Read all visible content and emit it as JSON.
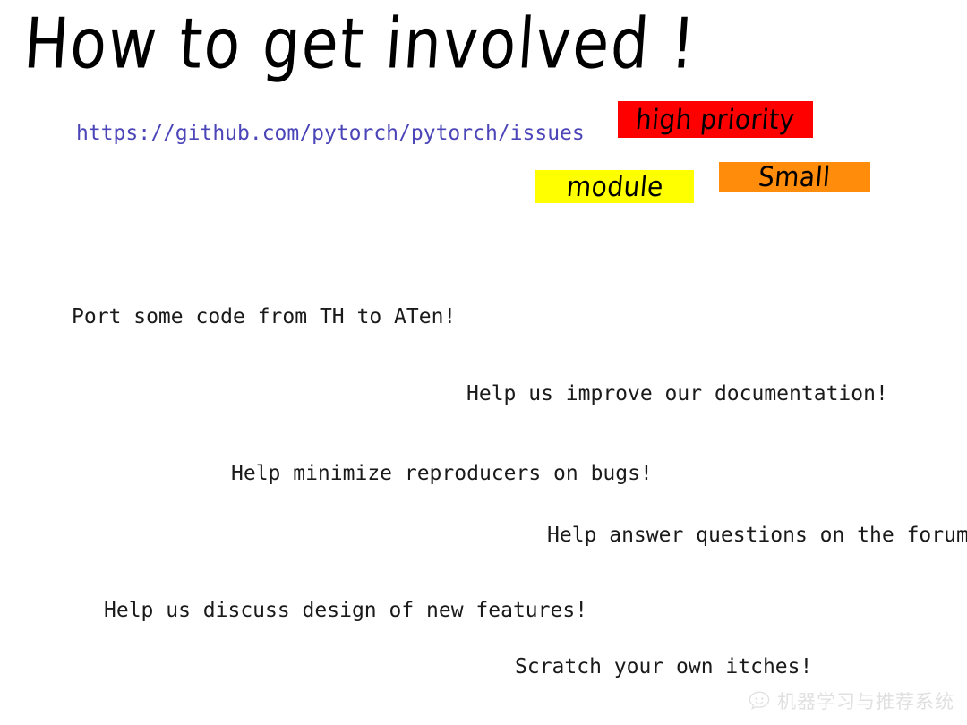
{
  "slide": {
    "title": "How to get  involved !",
    "issues_url": "https://github.com/pytorch/pytorch/issues",
    "background_color": "#ffffff"
  },
  "label_tags": [
    {
      "text": "high priority",
      "background_color": "#ff0000",
      "text_color": "#000000"
    },
    {
      "text": "module",
      "background_color": "#ffff00",
      "text_color": "#000000"
    },
    {
      "text": "Small",
      "background_color": "#ff8c0a",
      "text_color": "#000000"
    }
  ],
  "contribution_lines": [
    {
      "text": "Port some code from TH to ATen!"
    },
    {
      "text": "Help us improve our documentation!"
    },
    {
      "text": "Help minimize reproducers on bugs!"
    },
    {
      "text": "Help answer questions on the forums"
    },
    {
      "text": "Help us discuss design of new features!"
    },
    {
      "text": "Scratch your own itches!"
    }
  ],
  "watermark": {
    "icon": "speech-bubble-smiley-icon",
    "text": "机器学习与推荐系统"
  }
}
